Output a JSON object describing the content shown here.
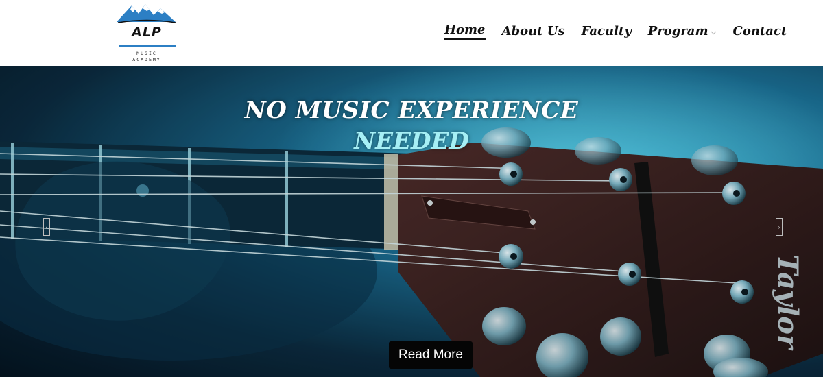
{
  "brand": {
    "name": "ALP",
    "line1": "MUSIC",
    "line2": "ACADEMY",
    "accent_color": "#2c7fc4"
  },
  "nav": {
    "items": [
      {
        "label": "Home",
        "active": true
      },
      {
        "label": "About Us"
      },
      {
        "label": "Faculty"
      },
      {
        "label": "Program",
        "has_dropdown": true,
        "dropdown_icon": "chevron-down-icon"
      },
      {
        "label": "Contact"
      }
    ]
  },
  "hero": {
    "title": "NO MUSIC EXPERIENCE",
    "subtitle": "NEEDED",
    "subtitle_color": "#a6eff5",
    "cta_label": "Read More",
    "prev_icon": "arrow-left-icon",
    "next_icon": "arrow-right-icon",
    "guitar_brand": "Taylor"
  }
}
